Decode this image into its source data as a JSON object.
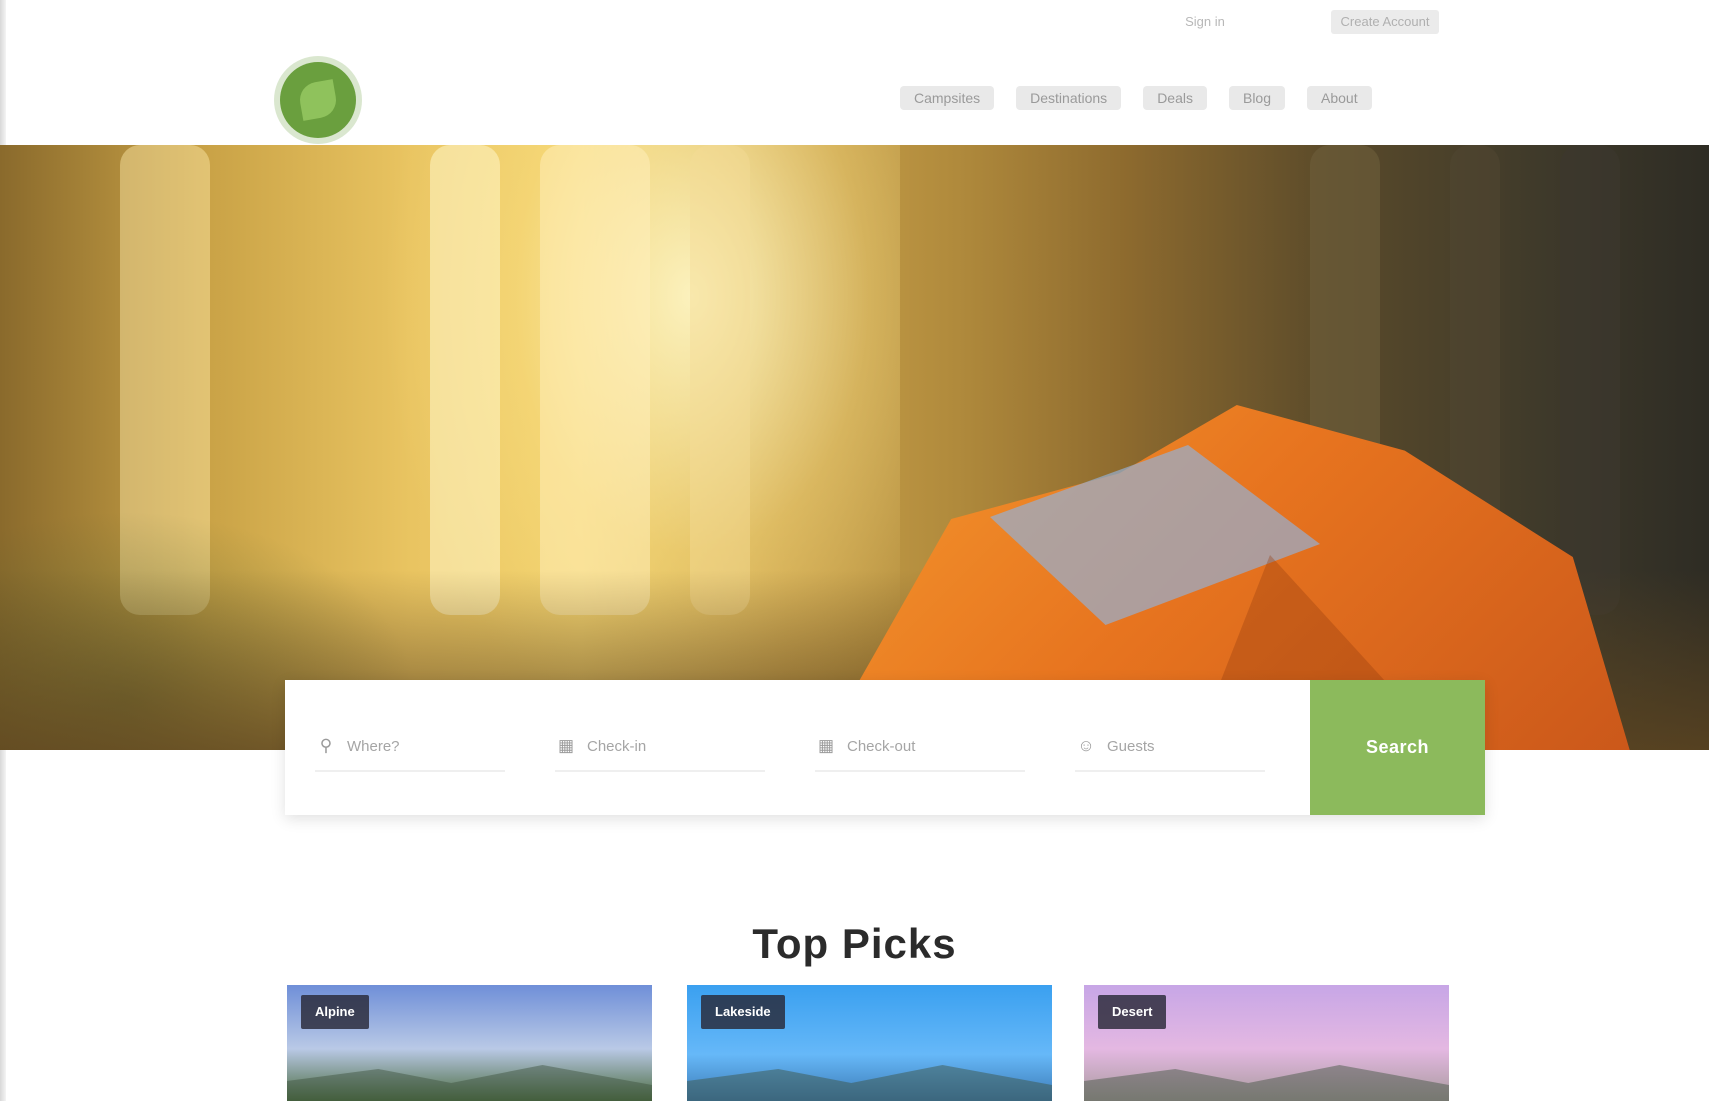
{
  "topbar": {
    "signin_label": "Sign in",
    "account_label": "Create Account"
  },
  "logo": {
    "alt": "Campsite logo"
  },
  "nav": {
    "items": [
      {
        "label": "Campsites"
      },
      {
        "label": "Destinations"
      },
      {
        "label": "Deals"
      },
      {
        "label": "Blog"
      },
      {
        "label": "About"
      }
    ]
  },
  "search": {
    "location_placeholder": "Where?",
    "checkin_placeholder": "Check-in",
    "checkout_placeholder": "Check-out",
    "guests_placeholder": "Guests",
    "button_label": "Search"
  },
  "section": {
    "title": "Top Picks"
  },
  "cards": [
    {
      "badge": "Alpine"
    },
    {
      "badge": "Lakeside"
    },
    {
      "badge": "Desert"
    }
  ],
  "colors": {
    "accent": "#8cba5c",
    "logo": "#6a9f3e",
    "tent": "#e7741f"
  }
}
